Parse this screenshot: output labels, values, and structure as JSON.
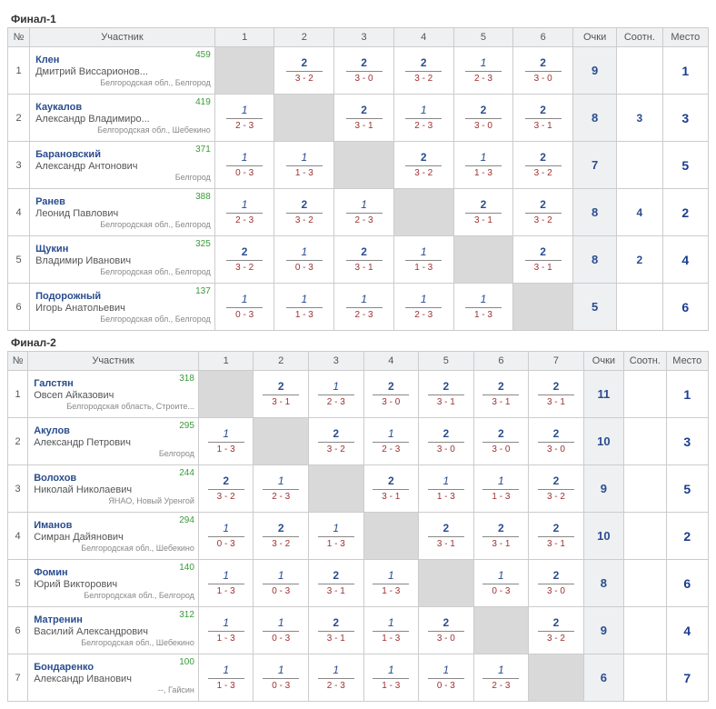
{
  "groups": [
    {
      "title": "Финал-1",
      "headers": {
        "num": "№",
        "participant": "Участник",
        "points": "Очки",
        "coef": "Соотн.",
        "place": "Место"
      },
      "opponent_count": 6,
      "rows": [
        {
          "num": "1",
          "rating": "459",
          "surname": "Клен",
          "name": "Дмитрий Виссарионов...",
          "location": "Белгородская обл., Белгород",
          "cells": [
            null,
            {
              "p": "2",
              "s": "3 - 2"
            },
            {
              "p": "2",
              "s": "3 - 0"
            },
            {
              "p": "2",
              "s": "3 - 2"
            },
            {
              "p": "1",
              "s": "2 - 3",
              "lost": true
            },
            {
              "p": "2",
              "s": "3 - 0"
            }
          ],
          "points": "9",
          "coef": "",
          "place": "1"
        },
        {
          "num": "2",
          "rating": "419",
          "surname": "Каукалов",
          "name": "Александр Владимиро...",
          "location": "Белгородская обл., Шебекино",
          "cells": [
            {
              "p": "1",
              "s": "2 - 3",
              "lost": true
            },
            null,
            {
              "p": "2",
              "s": "3 - 1"
            },
            {
              "p": "1",
              "s": "2 - 3",
              "lost": true
            },
            {
              "p": "2",
              "s": "3 - 0"
            },
            {
              "p": "2",
              "s": "3 - 1"
            }
          ],
          "points": "8",
          "coef": "3",
          "place": "3"
        },
        {
          "num": "3",
          "rating": "371",
          "surname": "Барановский",
          "name": "Александр Антонович",
          "location": "Белгород",
          "cells": [
            {
              "p": "1",
              "s": "0 - 3",
              "lost": true
            },
            {
              "p": "1",
              "s": "1 - 3",
              "lost": true
            },
            null,
            {
              "p": "2",
              "s": "3 - 2"
            },
            {
              "p": "1",
              "s": "1 - 3",
              "lost": true
            },
            {
              "p": "2",
              "s": "3 - 2"
            }
          ],
          "points": "7",
          "coef": "",
          "place": "5"
        },
        {
          "num": "4",
          "rating": "388",
          "surname": "Ранев",
          "name": "Леонид Павлович",
          "location": "Белгородская обл., Белгород",
          "cells": [
            {
              "p": "1",
              "s": "2 - 3",
              "lost": true
            },
            {
              "p": "2",
              "s": "3 - 2"
            },
            {
              "p": "1",
              "s": "2 - 3",
              "lost": true
            },
            null,
            {
              "p": "2",
              "s": "3 - 1"
            },
            {
              "p": "2",
              "s": "3 - 2"
            }
          ],
          "points": "8",
          "coef": "4",
          "place": "2"
        },
        {
          "num": "5",
          "rating": "325",
          "surname": "Щукин",
          "name": "Владимир Иванович",
          "location": "Белгородская обл., Белгород",
          "cells": [
            {
              "p": "2",
              "s": "3 - 2"
            },
            {
              "p": "1",
              "s": "0 - 3",
              "lost": true
            },
            {
              "p": "2",
              "s": "3 - 1"
            },
            {
              "p": "1",
              "s": "1 - 3",
              "lost": true
            },
            null,
            {
              "p": "2",
              "s": "3 - 1"
            }
          ],
          "points": "8",
          "coef": "2",
          "place": "4"
        },
        {
          "num": "6",
          "rating": "137",
          "surname": "Подорожный",
          "name": "Игорь Анатольевич",
          "location": "Белгородская обл., Белгород",
          "cells": [
            {
              "p": "1",
              "s": "0 - 3",
              "lost": true
            },
            {
              "p": "1",
              "s": "1 - 3",
              "lost": true
            },
            {
              "p": "1",
              "s": "2 - 3",
              "lost": true
            },
            {
              "p": "1",
              "s": "2 - 3",
              "lost": true
            },
            {
              "p": "1",
              "s": "1 - 3",
              "lost": true
            },
            null
          ],
          "points": "5",
          "coef": "",
          "place": "6"
        }
      ]
    },
    {
      "title": "Финал-2",
      "headers": {
        "num": "№",
        "participant": "Участник",
        "points": "Очки",
        "coef": "Соотн.",
        "place": "Место"
      },
      "opponent_count": 7,
      "rows": [
        {
          "num": "1",
          "rating": "318",
          "surname": "Галстян",
          "name": "Овсеп Айказович",
          "location": "Белгородская область, Строите...",
          "cells": [
            null,
            {
              "p": "2",
              "s": "3 - 1"
            },
            {
              "p": "1",
              "s": "2 - 3",
              "lost": true
            },
            {
              "p": "2",
              "s": "3 - 0"
            },
            {
              "p": "2",
              "s": "3 - 1"
            },
            {
              "p": "2",
              "s": "3 - 1"
            },
            {
              "p": "2",
              "s": "3 - 1"
            }
          ],
          "points": "11",
          "coef": "",
          "place": "1"
        },
        {
          "num": "2",
          "rating": "295",
          "surname": "Акулов",
          "name": "Александр Петрович",
          "location": "Белгород",
          "cells": [
            {
              "p": "1",
              "s": "1 - 3",
              "lost": true
            },
            null,
            {
              "p": "2",
              "s": "3 - 2"
            },
            {
              "p": "1",
              "s": "2 - 3",
              "lost": true
            },
            {
              "p": "2",
              "s": "3 - 0"
            },
            {
              "p": "2",
              "s": "3 - 0"
            },
            {
              "p": "2",
              "s": "3 - 0"
            }
          ],
          "points": "10",
          "coef": "",
          "place": "3"
        },
        {
          "num": "3",
          "rating": "244",
          "surname": "Волохов",
          "name": "Николай Николаевич",
          "location": "ЯНАО, Новый Уренгой",
          "cells": [
            {
              "p": "2",
              "s": "3 - 2"
            },
            {
              "p": "1",
              "s": "2 - 3",
              "lost": true
            },
            null,
            {
              "p": "2",
              "s": "3 - 1"
            },
            {
              "p": "1",
              "s": "1 - 3",
              "lost": true
            },
            {
              "p": "1",
              "s": "1 - 3",
              "lost": true
            },
            {
              "p": "2",
              "s": "3 - 2"
            }
          ],
          "points": "9",
          "coef": "",
          "place": "5"
        },
        {
          "num": "4",
          "rating": "294",
          "surname": "Иманов",
          "name": "Симран Дайянович",
          "location": "Белгородская обл., Шебекино",
          "cells": [
            {
              "p": "1",
              "s": "0 - 3",
              "lost": true
            },
            {
              "p": "2",
              "s": "3 - 2"
            },
            {
              "p": "1",
              "s": "1 - 3",
              "lost": true
            },
            null,
            {
              "p": "2",
              "s": "3 - 1"
            },
            {
              "p": "2",
              "s": "3 - 1"
            },
            {
              "p": "2",
              "s": "3 - 1"
            }
          ],
          "points": "10",
          "coef": "",
          "place": "2"
        },
        {
          "num": "5",
          "rating": "140",
          "surname": "Фомин",
          "name": "Юрий Викторович",
          "location": "Белгородская обл., Белгород",
          "cells": [
            {
              "p": "1",
              "s": "1 - 3",
              "lost": true
            },
            {
              "p": "1",
              "s": "0 - 3",
              "lost": true
            },
            {
              "p": "2",
              "s": "3 - 1"
            },
            {
              "p": "1",
              "s": "1 - 3",
              "lost": true
            },
            null,
            {
              "p": "1",
              "s": "0 - 3",
              "lost": true
            },
            {
              "p": "2",
              "s": "3 - 0"
            }
          ],
          "points": "8",
          "coef": "",
          "place": "6"
        },
        {
          "num": "6",
          "rating": "312",
          "surname": "Матренин",
          "name": "Василий Александрович",
          "location": "Белгородская обл., Шебекино",
          "cells": [
            {
              "p": "1",
              "s": "1 - 3",
              "lost": true
            },
            {
              "p": "1",
              "s": "0 - 3",
              "lost": true
            },
            {
              "p": "2",
              "s": "3 - 1"
            },
            {
              "p": "1",
              "s": "1 - 3",
              "lost": true
            },
            {
              "p": "2",
              "s": "3 - 0"
            },
            null,
            {
              "p": "2",
              "s": "3 - 2"
            }
          ],
          "points": "9",
          "coef": "",
          "place": "4"
        },
        {
          "num": "7",
          "rating": "100",
          "surname": "Бондаренко",
          "name": "Александр Иванович",
          "location": "--, Гайсин",
          "cells": [
            {
              "p": "1",
              "s": "1 - 3",
              "lost": true
            },
            {
              "p": "1",
              "s": "0 - 3",
              "lost": true
            },
            {
              "p": "1",
              "s": "2 - 3",
              "lost": true
            },
            {
              "p": "1",
              "s": "1 - 3",
              "lost": true
            },
            {
              "p": "1",
              "s": "0 - 3",
              "lost": true
            },
            {
              "p": "1",
              "s": "2 - 3",
              "lost": true
            },
            null
          ],
          "points": "6",
          "coef": "",
          "place": "7"
        }
      ]
    }
  ]
}
